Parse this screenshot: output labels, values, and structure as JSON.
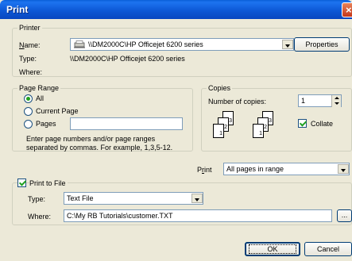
{
  "window": {
    "title": "Print"
  },
  "printer": {
    "group_label": "Printer",
    "name_label": "Name:",
    "name_value": "\\\\DM2000C\\HP Officejet 6200 series",
    "properties_button": "Properties",
    "type_label": "Type:",
    "type_value": "\\\\DM2000C\\HP Officejet 6200 series",
    "where_label": "Where:"
  },
  "page_range": {
    "group_label": "Page Range",
    "options": [
      "All",
      "Current Page",
      "Pages"
    ],
    "selected": "All",
    "help_line1": "Enter page numbers and/or page ranges",
    "help_line2": "separated by commas.  For example, 1,3,5-12."
  },
  "copies": {
    "group_label": "Copies",
    "number_label": "Number of copies:",
    "number_value": "1",
    "collate_label": "Collate",
    "collate_checked": true
  },
  "print_option": {
    "label": "Print",
    "value": "All pages in range"
  },
  "print_to_file": {
    "label": "Print to File",
    "checked": true,
    "type_label": "Type:",
    "type_value": "Text File",
    "where_label": "Where:",
    "where_value": "C:\\My RB Tutorials\\customer.TXT",
    "browse_label": "..."
  },
  "buttons": {
    "ok": "OK",
    "cancel": "Cancel"
  },
  "colors": {
    "titlebar": "#0d58d6",
    "dialog_bg": "#ece9d8",
    "check_mark": "#21a121"
  }
}
